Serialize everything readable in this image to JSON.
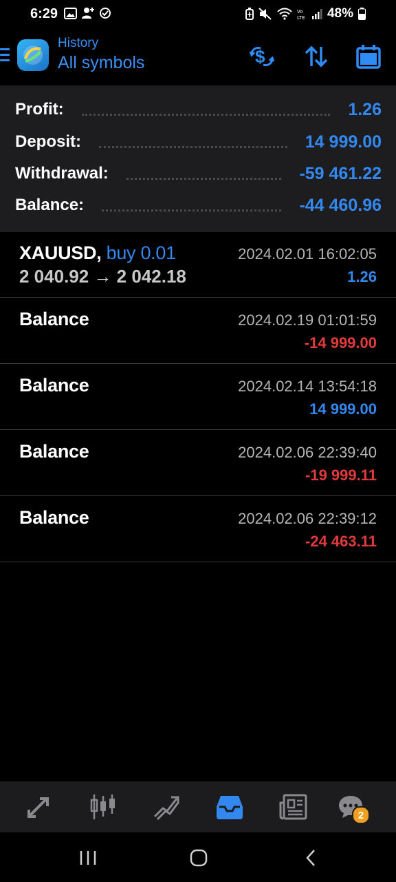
{
  "status_bar": {
    "time": "6:29",
    "battery": "48%",
    "left_icons": [
      "image-icon",
      "person-add-icon",
      "check-circle-icon"
    ],
    "right_icons": [
      "battery-saver-icon",
      "mute-icon",
      "wifi-icon",
      "volte-icon",
      "signal-icon",
      "battery-icon"
    ]
  },
  "header": {
    "subtitle": "History",
    "title": "All symbols",
    "buttons": [
      "currency-exchange-icon",
      "sort-icon",
      "calendar-icon"
    ],
    "accent_color": "#3a8ff2"
  },
  "summary": {
    "rows": [
      {
        "label": "Profit:",
        "value": "1.26"
      },
      {
        "label": "Deposit:",
        "value": "14 999.00"
      },
      {
        "label": "Withdrawal:",
        "value": "-59 461.22"
      },
      {
        "label": "Balance:",
        "value": "-44 460.96"
      }
    ]
  },
  "history": [
    {
      "symbol": "XAUUSD,",
      "side": "buy 0.01",
      "prices": "2 040.92 → 2 042.18",
      "date": "2024.02.01 16:02:05",
      "amount": "1.26",
      "positive": true
    },
    {
      "symbol": "Balance",
      "side": "",
      "prices": "",
      "date": "2024.02.19 01:01:59",
      "amount": "-14 999.00",
      "positive": false
    },
    {
      "symbol": "Balance",
      "side": "",
      "prices": "",
      "date": "2024.02.14 13:54:18",
      "amount": "14 999.00",
      "positive": true
    },
    {
      "symbol": "Balance",
      "side": "",
      "prices": "",
      "date": "2024.02.06 22:39:40",
      "amount": "-19 999.11",
      "positive": false
    },
    {
      "symbol": "Balance",
      "side": "",
      "prices": "",
      "date": "2024.02.06 22:39:12",
      "amount": "-24 463.11",
      "positive": false
    }
  ],
  "colors": {
    "positive": "#3388f0",
    "negative": "#e23b3b",
    "inactive_icon": "#8a8a8e",
    "active_icon": "#3388f0"
  },
  "bottom_nav": {
    "items": [
      "quotes-icon",
      "chart-icon",
      "trade-icon",
      "history-icon",
      "news-icon",
      "chat-icon"
    ],
    "active": "history-icon",
    "chat_badge": "2"
  },
  "system_nav": [
    "recents-icon",
    "home-icon",
    "back-icon"
  ]
}
